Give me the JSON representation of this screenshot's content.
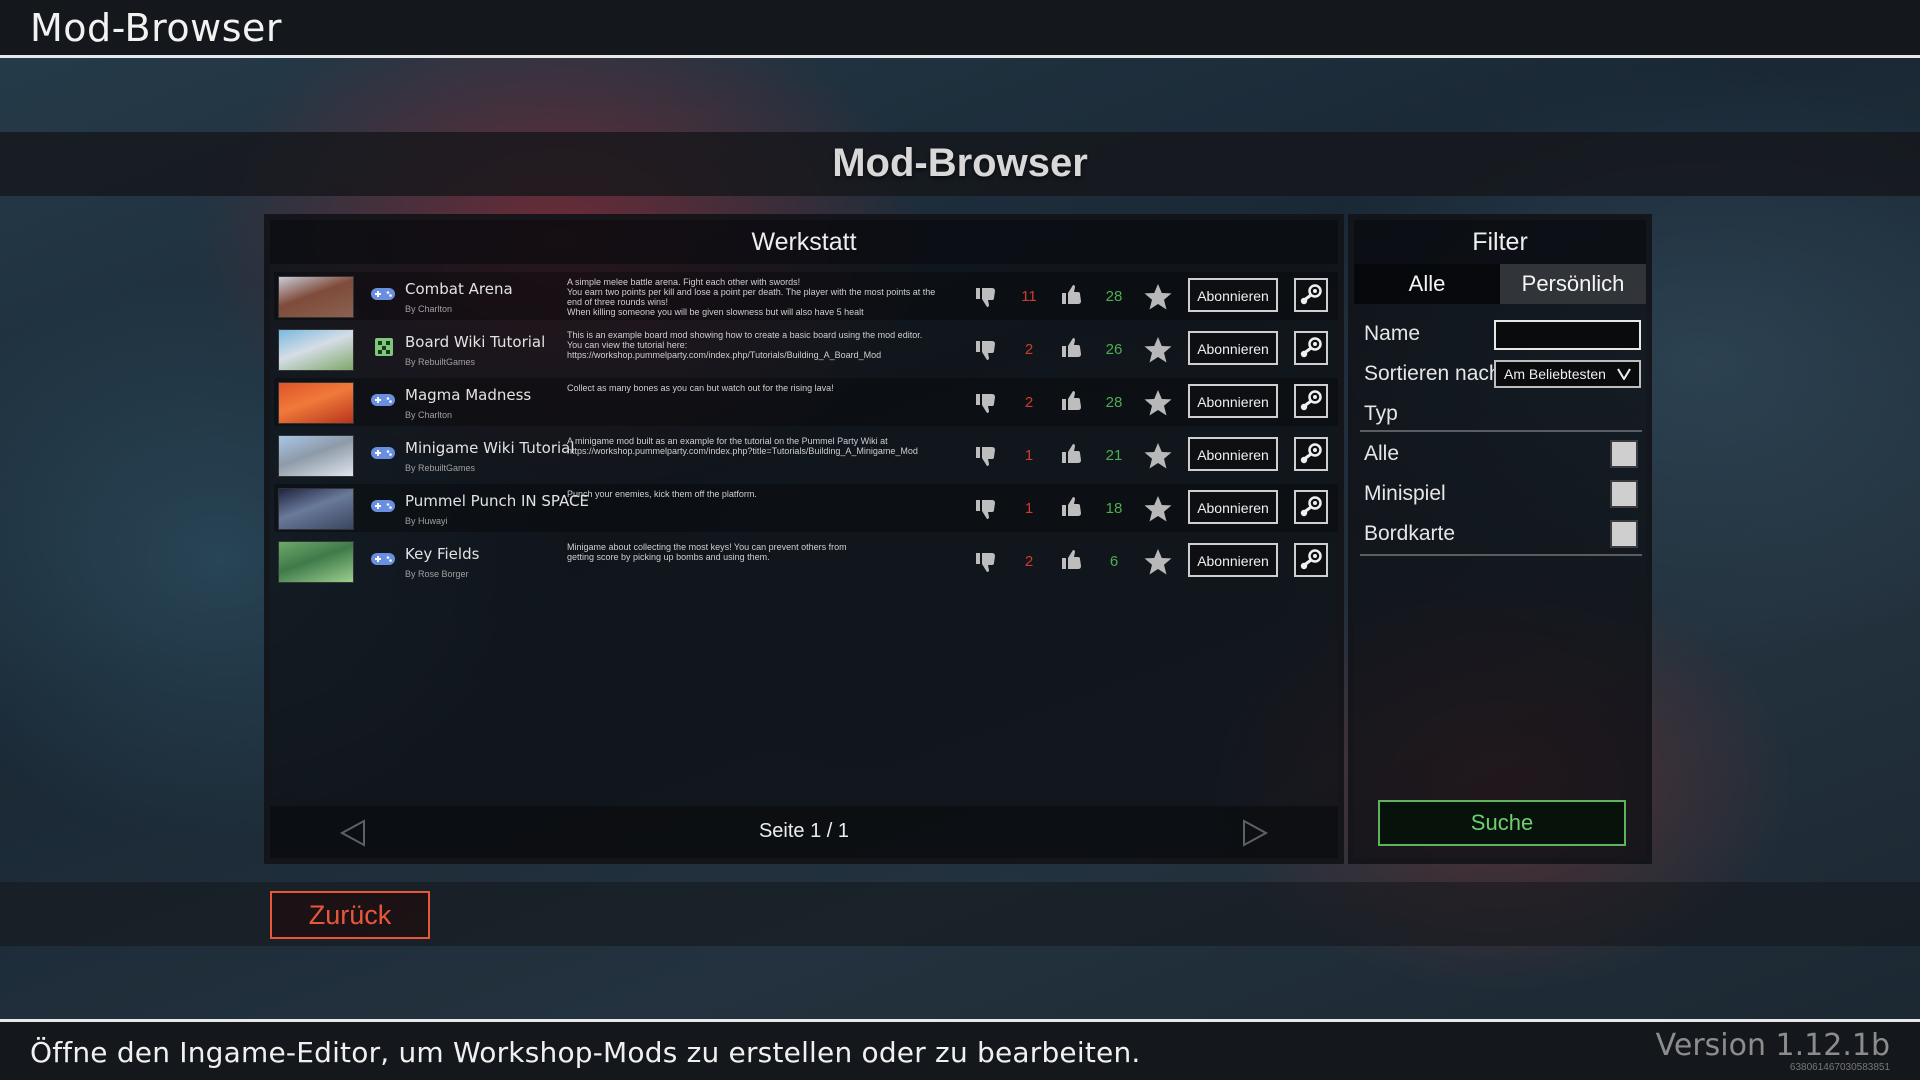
{
  "header": {
    "title": "Mod-Browser"
  },
  "banner": {
    "title": "Mod-Browser"
  },
  "workshop": {
    "title": "Werkstatt",
    "subscribe_label": "Abonnieren",
    "mods": [
      {
        "name": "Combat Arena",
        "author": "By Charlton",
        "type": "minigame",
        "description": "A simple melee battle arena. Fight each other with swords!\nYou earn two points per kill and lose a point per death. The player with the most points at the end of three rounds wins!\nWhen killing someone you will be given slowness but will also have 5 healt",
        "downvotes": "11",
        "upvotes": "28",
        "thumb_colors": [
          "#c9ccd8",
          "#8a6250",
          "#7f4b3a"
        ]
      },
      {
        "name": "Board Wiki Tutorial",
        "author": "By RebuiltGames",
        "type": "board",
        "description": "This is an example board mod showing how to create a basic board using the mod editor.\nYou can view the tutorial here:\nhttps://workshop.pummelparty.com/index.php/Tutorials/Building_A_Board_Mod",
        "downvotes": "2",
        "upvotes": "26",
        "thumb_colors": [
          "#7ab8e0",
          "#7fa86a",
          "#d5dde6"
        ]
      },
      {
        "name": "Magma Madness",
        "author": "By Charlton",
        "type": "minigame",
        "description": "Collect as many bones as you can but watch out for the rising lava!",
        "downvotes": "2",
        "upvotes": "28",
        "thumb_colors": [
          "#e0532a",
          "#b8341d",
          "#f07a3a"
        ]
      },
      {
        "name": "Minigame Wiki Tutorial",
        "author": "By RebuiltGames",
        "type": "minigame",
        "description": "A minigame mod built as an example for the tutorial on the Pummel Party Wiki at\nhttps://workshop.pummelparty.com/index.php?title=Tutorials/Building_A_Minigame_Mod",
        "downvotes": "1",
        "upvotes": "21",
        "thumb_colors": [
          "#a9c6e6",
          "#dfe6ee",
          "#8e9aa8"
        ]
      },
      {
        "name": "Pummel Punch IN SPACE",
        "author": "By Huwayi",
        "type": "minigame",
        "description": "Punch your enemies, kick them off the platform.",
        "downvotes": "1",
        "upvotes": "18",
        "thumb_colors": [
          "#1e2440",
          "#3a4660",
          "#6a7a9a"
        ]
      },
      {
        "name": "Key Fields",
        "author": "By Rose Borger",
        "type": "minigame",
        "description": "Minigame about collecting the most keys! You can prevent others from\ngetting score by picking up bombs and using them.",
        "downvotes": "2",
        "upvotes": "6",
        "thumb_colors": [
          "#6fa86a",
          "#9ccf8e",
          "#3f7a4a"
        ]
      }
    ],
    "pager": {
      "label": "Seite 1 / 1"
    }
  },
  "filter": {
    "title": "Filter",
    "tabs": {
      "all": "Alle",
      "personal": "Persönlich"
    },
    "name_label": "Name",
    "name_value": "",
    "sort_label": "Sortieren nach",
    "sort_value": "Am Beliebtesten",
    "type_label": "Typ",
    "types": {
      "all": "Alle",
      "minigame": "Minispiel",
      "board": "Bordkarte"
    },
    "search_label": "Suche"
  },
  "back_button": "Zurück",
  "footer": {
    "hint": "Öffne den Ingame-Editor, um Workshop-Mods zu erstellen oder zu bearbeiten.",
    "version": "Version 1.12.1b",
    "build": "638061467030583851"
  },
  "colors": {
    "downvote": "#d33a2e",
    "upvote": "#4caf50",
    "search": "#6fce6f",
    "back": "#e8573a",
    "minigame_icon": "#6b8fe0",
    "board_icon": "#7ec87e"
  }
}
